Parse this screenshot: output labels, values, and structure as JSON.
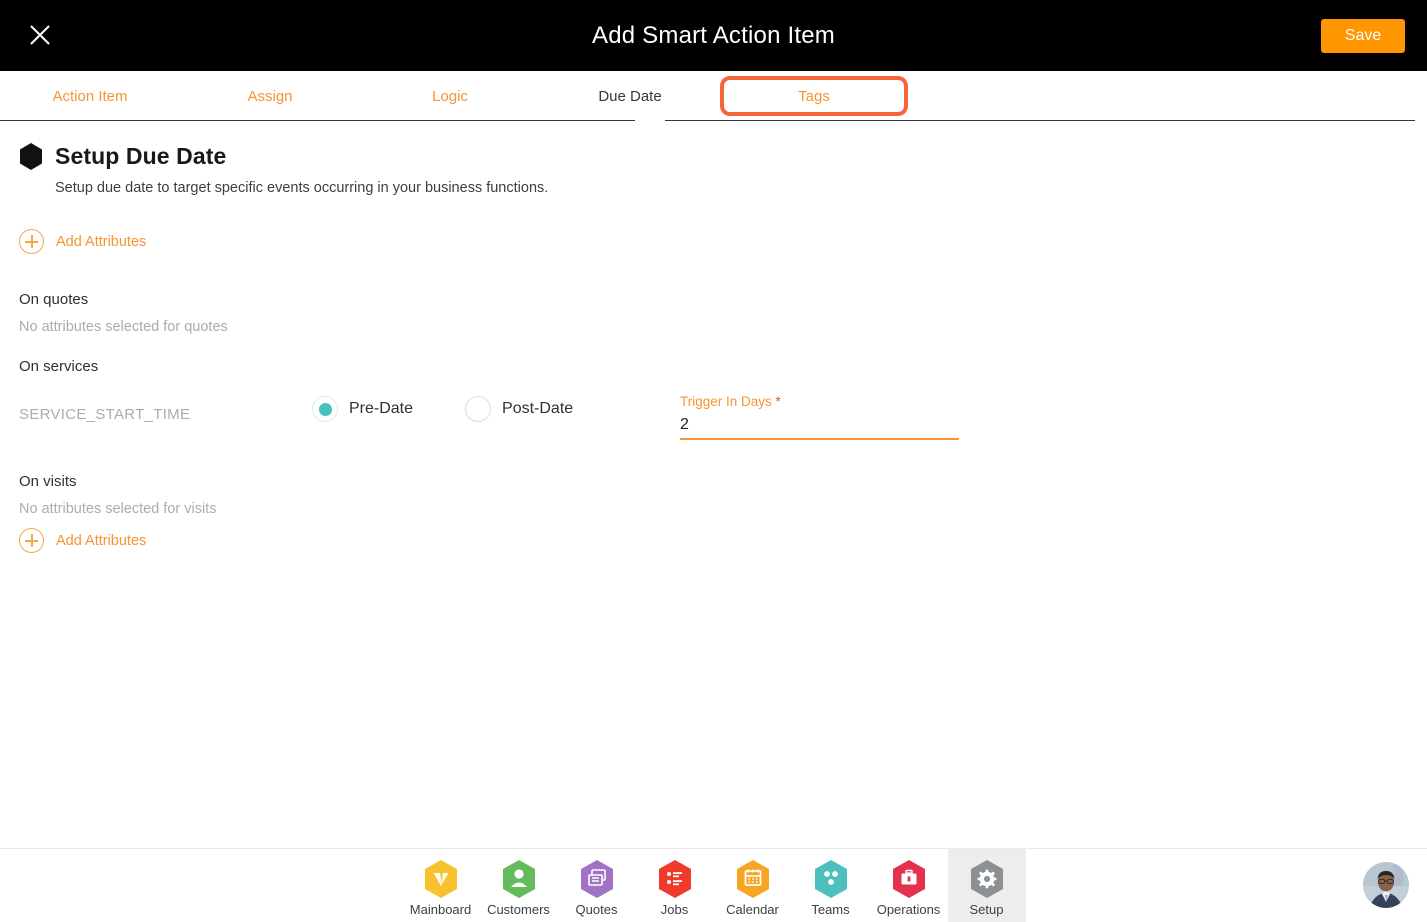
{
  "header": {
    "title": "Add Smart Action Item",
    "close_icon": "close-icon",
    "save_label": "Save"
  },
  "tabs": {
    "items": [
      {
        "label": "Action Item",
        "state": "inactive"
      },
      {
        "label": "Assign",
        "state": "inactive"
      },
      {
        "label": "Logic",
        "state": "inactive"
      },
      {
        "label": "Due Date",
        "state": "active"
      },
      {
        "label": "Tags",
        "state": "highlighted"
      }
    ]
  },
  "main": {
    "section_icon": "hexagon-icon",
    "section_title": "Setup Due Date",
    "section_subtitle": "Setup due date to target specific events occurring in your business functions.",
    "add_attributes_top_label": "Add Attributes",
    "add_attributes_bottom_label": "Add Attributes",
    "plus_icon": "plus-circle-icon",
    "groups": {
      "quotes": {
        "title": "On quotes",
        "empty_text": "No attributes selected for quotes"
      },
      "services": {
        "title": "On services",
        "attribute_name": "SERVICE_START_TIME",
        "radios": [
          {
            "label": "Pre-Date",
            "selected": true
          },
          {
            "label": "Post-Date",
            "selected": false
          }
        ],
        "trigger_field": {
          "label": "Trigger In Days",
          "required_marker": "*",
          "value": "2",
          "placeholder": ""
        }
      },
      "visits": {
        "title": "On visits",
        "empty_text": "No attributes selected for visits"
      }
    }
  },
  "bottom_nav": {
    "items": [
      {
        "label": "Mainboard",
        "icon": "mainboard-icon",
        "color": "#F8C22E",
        "active": false
      },
      {
        "label": "Customers",
        "icon": "customers-icon",
        "color": "#63BB5B",
        "active": false
      },
      {
        "label": "Quotes",
        "icon": "quotes-icon",
        "color": "#A073C4",
        "active": false
      },
      {
        "label": "Jobs",
        "icon": "jobs-icon",
        "color": "#EE3B2B",
        "active": false
      },
      {
        "label": "Calendar",
        "icon": "calendar-icon",
        "color": "#F6A623",
        "active": false
      },
      {
        "label": "Teams",
        "icon": "teams-icon",
        "color": "#4EBFBD",
        "active": false
      },
      {
        "label": "Operations",
        "icon": "operations-icon",
        "color": "#E4314F",
        "active": false
      },
      {
        "label": "Setup",
        "icon": "gear-icon",
        "color": "#8D9093",
        "active": true
      }
    ],
    "avatar": "user-avatar"
  },
  "colors": {
    "accent_orange": "#F79433",
    "save_orange": "#FF9500",
    "highlight_red": "#F4663A",
    "radio_teal": "#45C1BE",
    "required_red": "#F4442E",
    "header_black": "#000000"
  }
}
